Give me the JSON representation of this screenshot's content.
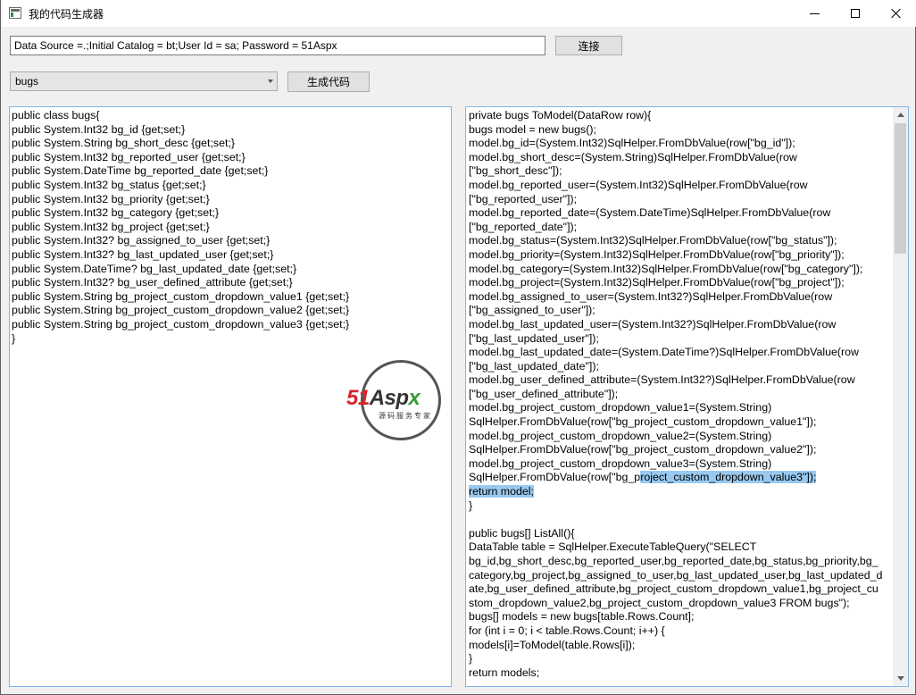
{
  "window": {
    "title": "我的代码生成器"
  },
  "connection": {
    "value": "Data Source =.;Initial Catalog = bt;User Id = sa; Password = 51Aspx",
    "connect_label": "连接"
  },
  "table_select": {
    "selected": "bugs"
  },
  "generate_label": "生成代码",
  "left_code": [
    "public class bugs{",
    "public System.Int32 bg_id {get;set;}",
    "public System.String bg_short_desc {get;set;}",
    "public System.Int32 bg_reported_user {get;set;}",
    "public System.DateTime bg_reported_date {get;set;}",
    "public System.Int32 bg_status {get;set;}",
    "public System.Int32 bg_priority {get;set;}",
    "public System.Int32 bg_category {get;set;}",
    "public System.Int32 bg_project {get;set;}",
    "public System.Int32? bg_assigned_to_user {get;set;}",
    "public System.Int32? bg_last_updated_user {get;set;}",
    "public System.DateTime? bg_last_updated_date {get;set;}",
    "public System.Int32? bg_user_defined_attribute {get;set;}",
    "public System.String bg_project_custom_dropdown_value1 {get;set;}",
    "public System.String bg_project_custom_dropdown_value2 {get;set;}",
    "public System.String bg_project_custom_dropdown_value3 {get;set;}",
    "}"
  ],
  "right_code": [
    "private bugs ToModel(DataRow row){",
    "bugs model = new bugs();",
    "model.bg_id=(System.Int32)SqlHelper.FromDbValue(row[\"bg_id\"]);",
    "model.bg_short_desc=(System.String)SqlHelper.FromDbValue(row",
    "[\"bg_short_desc\"]);",
    "model.bg_reported_user=(System.Int32)SqlHelper.FromDbValue(row",
    "[\"bg_reported_user\"]);",
    "model.bg_reported_date=(System.DateTime)SqlHelper.FromDbValue(row",
    "[\"bg_reported_date\"]);",
    "model.bg_status=(System.Int32)SqlHelper.FromDbValue(row[\"bg_status\"]);",
    "model.bg_priority=(System.Int32)SqlHelper.FromDbValue(row[\"bg_priority\"]);",
    "model.bg_category=(System.Int32)SqlHelper.FromDbValue(row[\"bg_category\"]);",
    "model.bg_project=(System.Int32)SqlHelper.FromDbValue(row[\"bg_project\"]);",
    "model.bg_assigned_to_user=(System.Int32?)SqlHelper.FromDbValue(row",
    "[\"bg_assigned_to_user\"]);",
    "model.bg_last_updated_user=(System.Int32?)SqlHelper.FromDbValue(row",
    "[\"bg_last_updated_user\"]);",
    "model.bg_last_updated_date=(System.DateTime?)SqlHelper.FromDbValue(row",
    "[\"bg_last_updated_date\"]);",
    "model.bg_user_defined_attribute=(System.Int32?)SqlHelper.FromDbValue(row",
    "[\"bg_user_defined_attribute\"]);",
    "model.bg_project_custom_dropdown_value1=(System.String)",
    "SqlHelper.FromDbValue(row[\"bg_project_custom_dropdown_value1\"]);",
    "model.bg_project_custom_dropdown_value2=(System.String)",
    "SqlHelper.FromDbValue(row[\"bg_project_custom_dropdown_value2\"]);",
    "model.bg_project_custom_dropdown_value3=(System.String)",
    "SqlHelper.FromDbValue(row[\"bg_p|roject_custom_dropdown_value3\"]);",
    "|return model;|",
    "}",
    "",
    "public bugs[] ListAll(){",
    "DataTable table = SqlHelper.ExecuteTableQuery(\"SELECT",
    "bg_id,bg_short_desc,bg_reported_user,bg_reported_date,bg_status,bg_priority,bg_",
    "category,bg_project,bg_assigned_to_user,bg_last_updated_user,bg_last_updated_d",
    "ate,bg_user_defined_attribute,bg_project_custom_dropdown_value1,bg_project_cu",
    "stom_dropdown_value2,bg_project_custom_dropdown_value3 FROM bugs\");",
    "bugs[] models = new bugs[table.Rows.Count];",
    "for (int i = 0; i < table.Rows.Count; i++) {",
    "models[i]=ToModel(table.Rows[i]);",
    "}",
    "return models;"
  ],
  "watermark": {
    "logo_text": "51Aspx",
    "tagline": "源码服务专家"
  }
}
